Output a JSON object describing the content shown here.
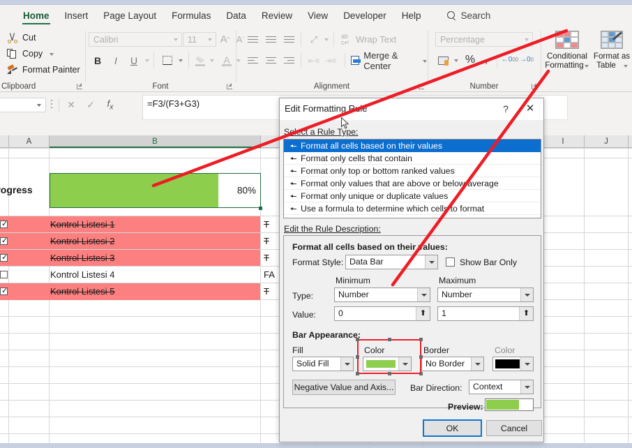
{
  "app": {
    "ribbon_tabs": [
      {
        "label": "Home",
        "active": true
      },
      {
        "label": "Insert",
        "active": false
      },
      {
        "label": "Page Layout",
        "active": false
      },
      {
        "label": "Formulas",
        "active": false
      },
      {
        "label": "Data",
        "active": false
      },
      {
        "label": "Review",
        "active": false
      },
      {
        "label": "View",
        "active": false
      },
      {
        "label": "Developer",
        "active": false
      },
      {
        "label": "Help",
        "active": false
      }
    ],
    "search_label": "Search",
    "search_icon": "search-icon"
  },
  "ribbon": {
    "clipboard": {
      "group_label": "Clipboard",
      "cut": "Cut",
      "copy": "Copy",
      "format_painter": "Format Painter",
      "cut_icon": "scissors-icon",
      "copy_icon": "copy-pages-icon",
      "format_painter_icon": "paintbrush-icon"
    },
    "font": {
      "group_label": "Font",
      "font_name": "Calibri",
      "font_size": "11",
      "grow_font": "A",
      "shrink_font": "A",
      "bold": "B",
      "italic": "I",
      "underline": "U"
    },
    "alignment": {
      "group_label": "Alignment",
      "wrap_text": "Wrap Text",
      "merge_center": "Merge & Center"
    },
    "number": {
      "group_label": "Number",
      "format": "Percentage",
      "percent": "%",
      "comma": "'"
    },
    "styles": {
      "conditional_formatting": "Conditional\nFormatting",
      "conditional_formatting_l1": "Conditional",
      "conditional_formatting_l2": "Formatting",
      "format_as_table_l1": "Format as",
      "format_as_table_l2": "Table"
    }
  },
  "formula_bar": {
    "name_box_value": "",
    "cancel_icon": "close-icon",
    "enter_icon": "check-icon",
    "function_icon": "fx-icon",
    "formula": "=F3/(F3+G3)"
  },
  "grid": {
    "columns": [
      {
        "letter": "A",
        "selected": false
      },
      {
        "letter": "B",
        "selected": true
      },
      {
        "letter": "I",
        "selected": false
      },
      {
        "letter": "J",
        "selected": false
      }
    ],
    "progress_cell": {
      "label": "Progress",
      "value_text": "80%",
      "fill_percent": 80,
      "bar_color": "#8dce4c",
      "selection_border_color": "#1f6b41"
    },
    "rows": [
      {
        "label": "Kontrol Listesi 1",
        "checked": true,
        "done": true,
        "right_text": "T"
      },
      {
        "label": "Kontrol Listesi 2",
        "checked": true,
        "done": true,
        "right_text": "T"
      },
      {
        "label": "Kontrol Listesi 3",
        "checked": true,
        "done": true,
        "right_text": "T"
      },
      {
        "label": "Kontrol Listesi 4",
        "checked": false,
        "done": false,
        "right_text": "FA"
      },
      {
        "label": "Kontrol Listesi 5",
        "checked": true,
        "done": true,
        "right_text": "T"
      }
    ],
    "highlight_color": "#fc8080"
  },
  "dialog": {
    "title": "Edit Formatting Rule",
    "help_label": "?",
    "close_label": "✕",
    "select_rule_type_label": "Select a Rule Type:",
    "rule_types": [
      {
        "label": "Format all cells based on their values",
        "selected": true
      },
      {
        "label": "Format only cells that contain",
        "selected": false
      },
      {
        "label": "Format only top or bottom ranked values",
        "selected": false
      },
      {
        "label": "Format only values that are above or below average",
        "selected": false
      },
      {
        "label": "Format only unique or duplicate values",
        "selected": false
      },
      {
        "label": "Use a formula to determine which cells to format",
        "selected": false
      }
    ],
    "edit_rule_description_label": "Edit the Rule Description:",
    "description_heading": "Format all cells based on their values:",
    "format_style_label": "Format Style:",
    "format_style_value": "Data Bar",
    "show_bar_only_label": "Show Bar Only",
    "show_bar_only_checked": false,
    "minimum_label": "Minimum",
    "maximum_label": "Maximum",
    "type_label": "Type:",
    "min_type_value": "Number",
    "max_type_value": "Number",
    "value_label": "Value:",
    "min_value": "0",
    "max_value": "1",
    "bar_appearance_label": "Bar Appearance:",
    "fill_label": "Fill",
    "fill_value": "Solid Fill",
    "color_label": "Color",
    "fill_color": "#8dce4c",
    "border_label": "Border",
    "border_value": "No Border",
    "border_color_label": "Color",
    "border_color": "#000000",
    "negative_value_button": "Negative Value and Axis...",
    "bar_direction_label": "Bar Direction:",
    "bar_direction_value": "Context",
    "preview_label": "Preview:",
    "preview_fill_percent": 72,
    "ok_label": "OK",
    "cancel_label": "Cancel"
  },
  "annotation": {
    "color": "#ee1c25",
    "highlight_box_label": "color-picker-highlight"
  }
}
